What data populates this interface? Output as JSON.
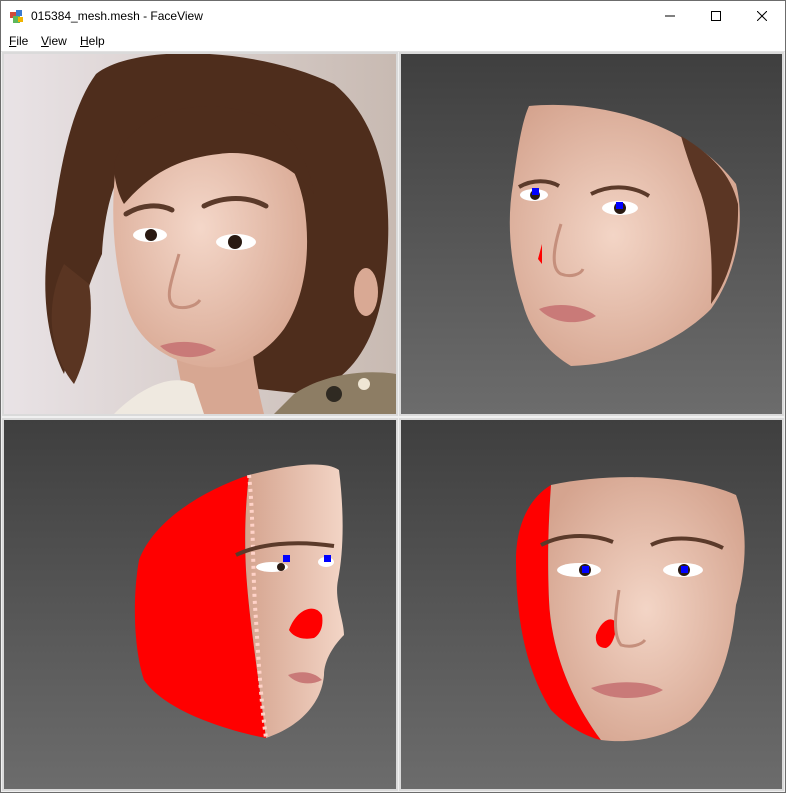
{
  "window": {
    "title": "015384_mesh.mesh - FaceView",
    "app_icon": "faceview-app-icon",
    "controls": {
      "minimize": "minimize-icon",
      "maximize": "maximize-icon",
      "close": "close-icon"
    }
  },
  "menu": {
    "file_accel": "F",
    "file_rest": "ile",
    "view_accel": "V",
    "view_rest": "iew",
    "help_accel": "H",
    "help_rest": "elp"
  },
  "viewports": [
    {
      "id": "source-photo",
      "content": "photo of woman with long dark curly hair"
    },
    {
      "id": "front-mesh",
      "content": "textured face mesh front view with blue landmark markers"
    },
    {
      "id": "side-mesh",
      "content": "textured face mesh side view with red occluded regions and blue landmarks"
    },
    {
      "id": "three-quarter-mesh",
      "content": "textured face mesh three-quarter view with red occluded regions and blue landmarks"
    }
  ],
  "colors": {
    "viewport_bg_top": "#3f3f3f",
    "viewport_bg_bottom": "#6c6c6c",
    "occlusion_red": "#ff0000",
    "landmark_blue": "#0000ff",
    "skin": "#e8c2ae"
  }
}
